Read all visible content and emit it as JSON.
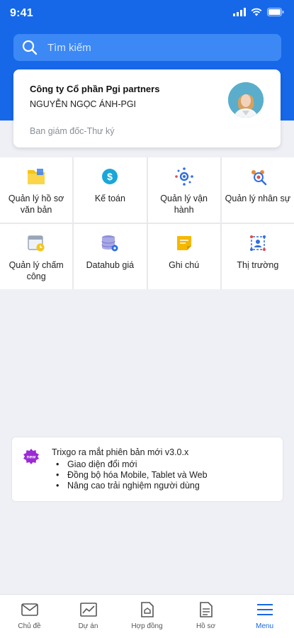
{
  "status": {
    "time": "9:41"
  },
  "search": {
    "placeholder": "Tìm kiếm"
  },
  "profile": {
    "company": "Công ty Cổ phần Pgi partners",
    "name": "NGUYỄN NGỌC ÁNH-PGI",
    "role": "Ban giám đốc-Thư ký"
  },
  "modules": [
    {
      "label": "Quản lý hồ sơ văn bản",
      "icon": "folder-icon"
    },
    {
      "label": "Kế toán",
      "icon": "dollar-coin-icon"
    },
    {
      "label": "Quản lý vận hành",
      "icon": "gear-network-icon"
    },
    {
      "label": "Quản lý nhân sự",
      "icon": "people-search-icon"
    },
    {
      "label": "Quản lý chấm công",
      "icon": "calendar-clock-icon"
    },
    {
      "label": "Datahub giá",
      "icon": "database-icon"
    },
    {
      "label": "Ghi chú",
      "icon": "sticky-note-icon"
    },
    {
      "label": "Thị trường",
      "icon": "market-network-icon"
    }
  ],
  "news": {
    "badge": "new",
    "title": "Trixgo ra mắt phiên bản mới v3.0.x",
    "items": [
      "Giao diện đổi mới",
      "Đồng bộ hóa Mobile, Tablet và Web",
      "Nâng cao trải nghiệm người dùng"
    ]
  },
  "tabs": [
    {
      "label": "Chủ đề",
      "icon": "mail-icon"
    },
    {
      "label": "Dự án",
      "icon": "chart-icon"
    },
    {
      "label": "Hợp đồng",
      "icon": "house-document-icon"
    },
    {
      "label": "Hồ sơ",
      "icon": "document-icon"
    },
    {
      "label": "Menu",
      "icon": "menu-icon"
    }
  ],
  "colors": {
    "primary": "#1668e8",
    "background": "#eef0f5",
    "badge": "#9b2bd6"
  }
}
